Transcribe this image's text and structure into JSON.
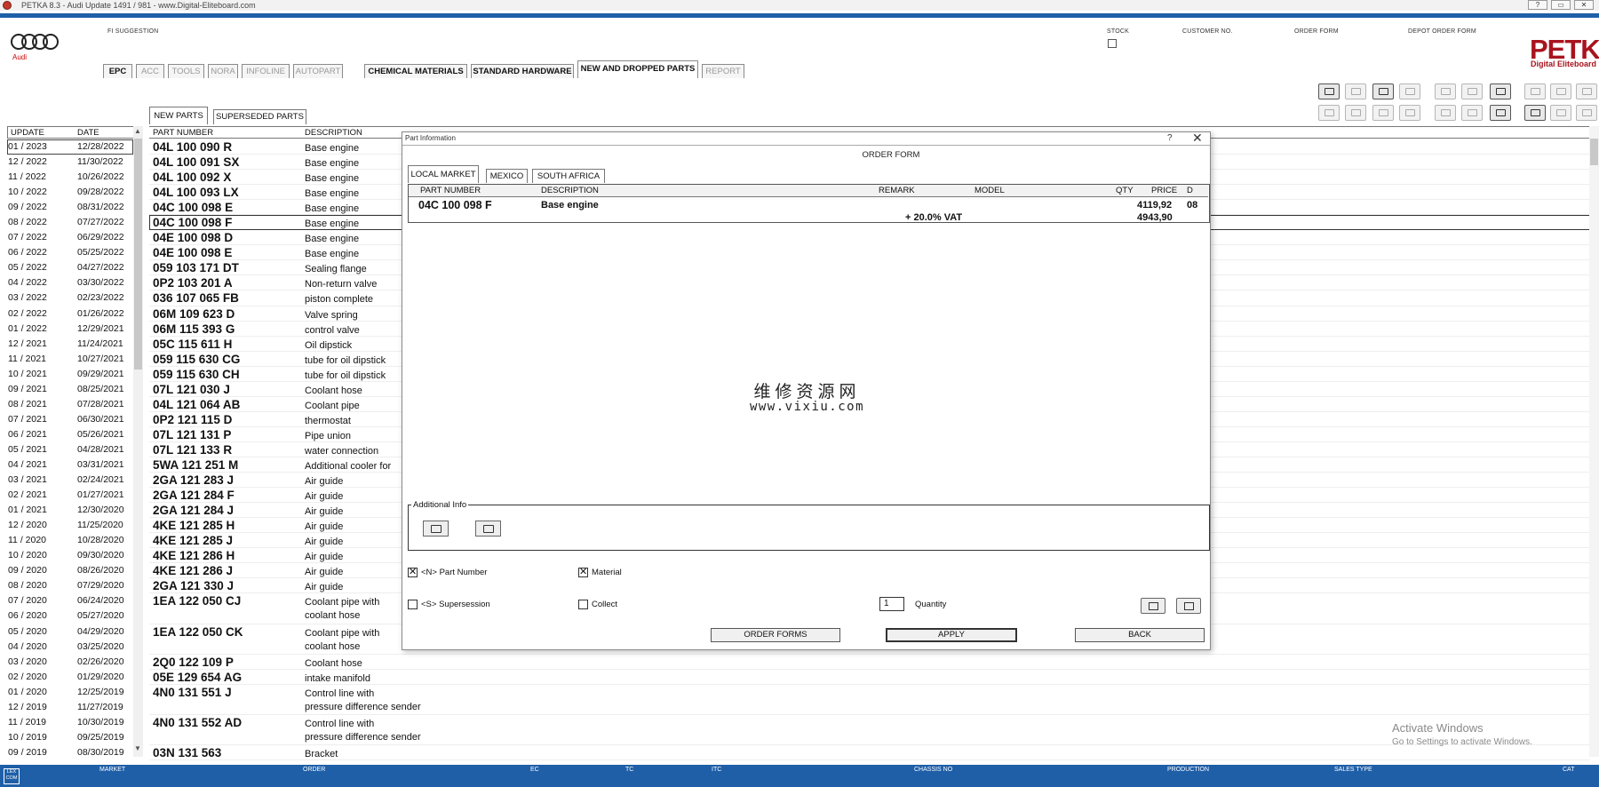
{
  "window": {
    "title": "PETKA 8.3 - Audi Update 1491 / 981 - www.Digital-Eliteboard.com",
    "controls": [
      "?",
      "▭",
      "✕"
    ]
  },
  "header": {
    "brand": "Audi",
    "fi_suggestion": "FI SUGGESTION",
    "stock": "STOCK",
    "customer_no": "CUSTOMER NO.",
    "order_form": "ORDER FORM",
    "depot_order_form": "DEPOT ORDER FORM",
    "petka": "PETKA",
    "petka_sub": "Digital Eliteboard"
  },
  "main_tabs": [
    {
      "label": "EPC",
      "enabled": true
    },
    {
      "label": "ACC",
      "enabled": false
    },
    {
      "label": "TOOLS",
      "enabled": false
    },
    {
      "label": "NORA",
      "enabled": false
    },
    {
      "label": "INFOLINE",
      "enabled": false
    },
    {
      "label": "AUTOPART",
      "enabled": false
    },
    {
      "label": "CHEMICAL MATERIALS",
      "enabled": true
    },
    {
      "label": "STANDARD HARDWARE",
      "enabled": true
    },
    {
      "label": "NEW AND DROPPED PARTS",
      "enabled": true,
      "active": true
    },
    {
      "label": "REPORT",
      "enabled": false
    }
  ],
  "sub_tabs": [
    "NEW PARTS",
    "SUPERSEDED PARTS"
  ],
  "left_table": {
    "headers": [
      "UPDATE",
      "DATE"
    ],
    "rows": [
      [
        "01 / 2023",
        "12/28/2022"
      ],
      [
        "12 / 2022",
        "11/30/2022"
      ],
      [
        "11 / 2022",
        "10/26/2022"
      ],
      [
        "10 / 2022",
        "09/28/2022"
      ],
      [
        "09 / 2022",
        "08/31/2022"
      ],
      [
        "08 / 2022",
        "07/27/2022"
      ],
      [
        "07 / 2022",
        "06/29/2022"
      ],
      [
        "06 / 2022",
        "05/25/2022"
      ],
      [
        "05 / 2022",
        "04/27/2022"
      ],
      [
        "04 / 2022",
        "03/30/2022"
      ],
      [
        "03 / 2022",
        "02/23/2022"
      ],
      [
        "02 / 2022",
        "01/26/2022"
      ],
      [
        "01 / 2022",
        "12/29/2021"
      ],
      [
        "12 / 2021",
        "11/24/2021"
      ],
      [
        "11 / 2021",
        "10/27/2021"
      ],
      [
        "10 / 2021",
        "09/29/2021"
      ],
      [
        "09 / 2021",
        "08/25/2021"
      ],
      [
        "08 / 2021",
        "07/28/2021"
      ],
      [
        "07 / 2021",
        "06/30/2021"
      ],
      [
        "06 / 2021",
        "05/26/2021"
      ],
      [
        "05 / 2021",
        "04/28/2021"
      ],
      [
        "04 / 2021",
        "03/31/2021"
      ],
      [
        "03 / 2021",
        "02/24/2021"
      ],
      [
        "02 / 2021",
        "01/27/2021"
      ],
      [
        "01 / 2021",
        "12/30/2020"
      ],
      [
        "12 / 2020",
        "11/25/2020"
      ],
      [
        "11 / 2020",
        "10/28/2020"
      ],
      [
        "10 / 2020",
        "09/30/2020"
      ],
      [
        "09 / 2020",
        "08/26/2020"
      ],
      [
        "08 / 2020",
        "07/29/2020"
      ],
      [
        "07 / 2020",
        "06/24/2020"
      ],
      [
        "06 / 2020",
        "05/27/2020"
      ],
      [
        "05 / 2020",
        "04/29/2020"
      ],
      [
        "04 / 2020",
        "03/25/2020"
      ],
      [
        "03 / 2020",
        "02/26/2020"
      ],
      [
        "02 / 2020",
        "01/29/2020"
      ],
      [
        "01 / 2020",
        "12/25/2019"
      ],
      [
        "12 / 2019",
        "11/27/2019"
      ],
      [
        "11 / 2019",
        "10/30/2019"
      ],
      [
        "10 / 2019",
        "09/25/2019"
      ],
      [
        "09 / 2019",
        "08/30/2019"
      ]
    ]
  },
  "parts_table": {
    "headers": [
      "PART NUMBER",
      "DESCRIPTION"
    ],
    "rows": [
      {
        "pn": "04L 100 090 R",
        "desc": "Base engine"
      },
      {
        "pn": "04L 100 091 SX",
        "desc": "Base engine"
      },
      {
        "pn": "04L 100 092  X",
        "desc": "Base engine"
      },
      {
        "pn": "04L 100 093 LX",
        "desc": "Base engine"
      },
      {
        "pn": "04C 100 098 E",
        "desc": "Base engine"
      },
      {
        "pn": "04C 100 098 F",
        "desc": "Base engine",
        "selected": true
      },
      {
        "pn": "04E 100 098 D",
        "desc": "Base engine"
      },
      {
        "pn": "04E 100 098 E",
        "desc": "Base engine"
      },
      {
        "pn": "059 103 171 DT",
        "desc": "Sealing flange"
      },
      {
        "pn": "0P2 103 201 A",
        "desc": "Non-return valve"
      },
      {
        "pn": "036 107 065 FB",
        "desc": "piston complete"
      },
      {
        "pn": "06M 109 623 D",
        "desc": "Valve spring"
      },
      {
        "pn": "06M 115 393 G",
        "desc": "control valve"
      },
      {
        "pn": "05C 115 611 H",
        "desc": "Oil dipstick"
      },
      {
        "pn": "059 115 630 CG",
        "desc": "tube for oil dipstick"
      },
      {
        "pn": "059 115 630 CH",
        "desc": "tube for oil dipstick"
      },
      {
        "pn": "07L 121 030 J",
        "desc": "Coolant hose"
      },
      {
        "pn": "04L 121 064 AB",
        "desc": "Coolant pipe"
      },
      {
        "pn": "0P2 121 115 D",
        "desc": "thermostat"
      },
      {
        "pn": "07L 121 131 P",
        "desc": "Pipe union"
      },
      {
        "pn": "07L 121 133 R",
        "desc": "water connection"
      },
      {
        "pn": "5WA 121 251 M",
        "desc": "Additional cooler for"
      },
      {
        "pn": "2GA 121 283 J",
        "desc": "Air guide"
      },
      {
        "pn": "2GA 121 284 F",
        "desc": "Air guide"
      },
      {
        "pn": "2GA 121 284 J",
        "desc": "Air guide"
      },
      {
        "pn": "4KE 121 285 H",
        "desc": "Air guide"
      },
      {
        "pn": "4KE 121 285 J",
        "desc": "Air guide"
      },
      {
        "pn": "4KE 121 286 H",
        "desc": "Air guide"
      },
      {
        "pn": "4KE 121 286 J",
        "desc": "Air guide"
      },
      {
        "pn": "2GA 121 330 J",
        "desc": "Air guide"
      },
      {
        "pn": "1EA 122 050 CJ",
        "desc": "Coolant pipe with",
        "desc2": "coolant hose"
      },
      {
        "pn": "1EA 122 050 CK",
        "desc": "Coolant pipe with",
        "desc2": "coolant hose"
      },
      {
        "pn": "2Q0 122 109 P",
        "desc": "Coolant hose"
      },
      {
        "pn": "05E 129 654 AG",
        "desc": "intake manifold"
      },
      {
        "pn": "4N0 131 551 J",
        "desc": "Control line with",
        "desc2": "pressure difference sender"
      },
      {
        "pn": "4N0 131 552 AD",
        "desc": "Control line with",
        "desc2": "pressure difference sender"
      },
      {
        "pn": "03N 131 563",
        "desc": "Bracket"
      }
    ]
  },
  "dialog": {
    "title": "Part Information",
    "help": "?",
    "close": "✕",
    "heading": "ORDER FORM",
    "tabs": [
      "LOCAL MARKET",
      "MEXICO",
      "SOUTH AFRICA"
    ],
    "table_headers": [
      "PART NUMBER",
      "DESCRIPTION",
      "REMARK",
      "MODEL",
      "QTY",
      "PRICE",
      "D"
    ],
    "row": {
      "pn": "04C 100 098 F",
      "desc": "Base engine",
      "price": "4119,92",
      "d": "08"
    },
    "vat_label": "+ 20.0% VAT",
    "vat_price": "4943,90",
    "watermark_cn": "维修资源网",
    "watermark_url": "www.vixiu.com",
    "additional_info": "Additional Info",
    "opt_part_number": "<N> Part Number",
    "opt_material": "Material",
    "opt_supersession": "<S> Supersession",
    "opt_collect": "Collect",
    "quantity_value": "1",
    "quantity_label": "Quantity",
    "btn_order_forms": "ORDER FORMS",
    "btn_apply": "APPLY",
    "btn_back": "BACK",
    "checked_mark": "✕"
  },
  "desktop": {
    "activate": "Activate Windows",
    "activate_sub": "Go to Settings to activate Windows."
  },
  "statusbar": {
    "lex": "LEX COM",
    "market": "MARKET",
    "order": "ORDER",
    "ec": "EC",
    "tc": "TC",
    "itc": "ITC",
    "chassis": "CHASSIS NO",
    "production": "PRODUCTION",
    "sales_type": "SALES TYPE",
    "cat": "CAT"
  },
  "colors": {
    "accent_blue": "#1f5fa8",
    "petka_red": "#a8141e",
    "audi_red": "#cc0000"
  }
}
